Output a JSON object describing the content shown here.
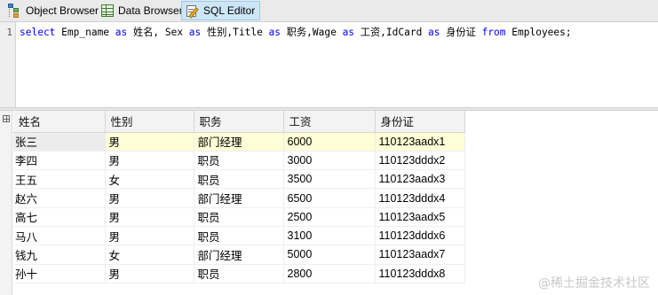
{
  "toolbar": {
    "tabs": [
      {
        "label": "Object Browser",
        "icon": "object-browser-icon"
      },
      {
        "label": "Data Browser",
        "icon": "data-browser-icon"
      },
      {
        "label": "SQL Editor",
        "icon": "sql-editor-icon",
        "active": true
      }
    ]
  },
  "editor": {
    "line_number": "1",
    "sql_tokens": [
      {
        "text": "select",
        "kw": true
      },
      {
        "text": " Emp_name ",
        "kw": false
      },
      {
        "text": "as",
        "kw": true
      },
      {
        "text": " 姓名, Sex ",
        "kw": false
      },
      {
        "text": "as",
        "kw": true
      },
      {
        "text": " 性别,Title ",
        "kw": false
      },
      {
        "text": "as",
        "kw": true
      },
      {
        "text": " 职务,Wage ",
        "kw": false
      },
      {
        "text": "as",
        "kw": true
      },
      {
        "text": " 工资,IdCard ",
        "kw": false
      },
      {
        "text": "as",
        "kw": true
      },
      {
        "text": " 身份证 ",
        "kw": false
      },
      {
        "text": "from",
        "kw": true
      },
      {
        "text": " Employees;",
        "kw": false
      }
    ]
  },
  "results": {
    "columns": [
      "姓名",
      "性别",
      "职务",
      "工资",
      "身份证"
    ],
    "selected_row": 0,
    "rows": [
      [
        "张三",
        "男",
        "部门经理",
        "6000",
        "110123aadx1"
      ],
      [
        "李四",
        "男",
        "职员",
        "3000",
        "110123dddx2"
      ],
      [
        "王五",
        "女",
        "职员",
        "3500",
        "110123aadx3"
      ],
      [
        "赵六",
        "男",
        "部门经理",
        "6500",
        "110123dddx4"
      ],
      [
        "高七",
        "男",
        "职员",
        "2500",
        "110123aadx5"
      ],
      [
        "马八",
        "男",
        "职员",
        "3100",
        "110123dddx6"
      ],
      [
        "钱九",
        "女",
        "部门经理",
        "5000",
        "110123aadx7"
      ],
      [
        "孙十",
        "男",
        "职员",
        "2800",
        "110123dddx8"
      ]
    ]
  },
  "watermark": "@稀土掘金技术社区",
  "colors": {
    "keyword": "#0000ff",
    "selected_row": "#fefdd6",
    "active_tab": "#cde6f7"
  }
}
